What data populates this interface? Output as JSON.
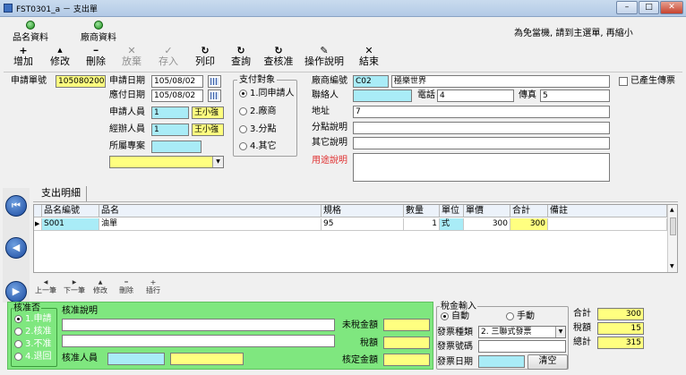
{
  "window": {
    "title": "FST0301_a － 支出單",
    "min": "–",
    "max": "□",
    "close": "✕"
  },
  "tabs": [
    {
      "label": "品名資料"
    },
    {
      "label": "廠商資料"
    }
  ],
  "notice": "為免當機, 請到主選單, 再縮小",
  "toolbar": [
    {
      "glyph": "+",
      "label": "增加",
      "enabled": true
    },
    {
      "glyph": "▲",
      "label": "修改",
      "enabled": true
    },
    {
      "glyph": "━",
      "label": "刪除",
      "enabled": true
    },
    {
      "glyph": "✕",
      "label": "放棄",
      "enabled": false
    },
    {
      "glyph": "✓",
      "label": "存入",
      "enabled": false
    },
    {
      "glyph": "↻",
      "label": "列印",
      "enabled": true
    },
    {
      "glyph": "↻",
      "label": "查詢",
      "enabled": true
    },
    {
      "glyph": "↻",
      "label": "查核准",
      "enabled": true
    },
    {
      "glyph": "✎",
      "label": "操作說明",
      "enabled": true
    },
    {
      "glyph": "✕",
      "label": "結束",
      "enabled": true
    }
  ],
  "form": {
    "req_no_label": "申請單號",
    "req_no": "1050802002",
    "req_date_label": "申請日期",
    "req_date": "105/08/02",
    "pay_date_label": "應付日期",
    "pay_date": "105/08/02",
    "applicant_label": "申請人員",
    "applicant_id": "1",
    "applicant_name": "王小強",
    "handler_label": "經辦人員",
    "handler_id": "1",
    "handler_name": "王小強",
    "project_label": "所屬專案",
    "project": "",
    "select_value": ""
  },
  "payment": {
    "title": "支付對象",
    "options": [
      {
        "label": "1.同申請人",
        "checked": true
      },
      {
        "label": "2.廠商",
        "checked": false
      },
      {
        "label": "3.分點",
        "checked": false
      },
      {
        "label": "4.其它",
        "checked": false
      }
    ]
  },
  "vendor": {
    "code_label": "廠商編號",
    "code": "C02",
    "name": "極樂世界",
    "contact_label": "聯絡人",
    "contact": "",
    "phone_label": "電話",
    "phone": "4",
    "fax_label": "傳真",
    "fax": "5",
    "address_label": "地址",
    "address": "7",
    "branch_label": "分點說明",
    "branch": "",
    "other_label": "其它說明",
    "other": "",
    "purpose_label": "用途說明",
    "purpose": "",
    "fax_check_label": "已產生傳票"
  },
  "detail": {
    "tab_label": "支出明細",
    "columns": [
      "品名編號",
      "品名",
      "規格",
      "數量",
      "單位",
      "單價",
      "合計",
      "備註"
    ],
    "rows": [
      {
        "code": "S001",
        "name": "油單",
        "spec": "95",
        "qty": "1",
        "unit": "式",
        "price": "300",
        "total": "300",
        "note": ""
      }
    ],
    "nav": [
      "上一筆",
      "下一筆",
      "修改",
      "刪除",
      "插行"
    ],
    "nav_glyphs": [
      "◀",
      "▶",
      "▲",
      "━",
      "+"
    ]
  },
  "approval": {
    "title": "核准否",
    "options": [
      {
        "label": "1.申請",
        "checked": true
      },
      {
        "label": "2.核准",
        "checked": false
      },
      {
        "label": "3.不准",
        "checked": false
      },
      {
        "label": "4.退回",
        "checked": false
      }
    ],
    "desc_label": "核准說明",
    "approver_label": "核准人員",
    "untaxed_label": "未稅金額",
    "tax_label": "稅額",
    "approved_amount_label": "核定金額"
  },
  "tax": {
    "title": "稅金輸入",
    "auto_label": "自動",
    "manual_label": "手動",
    "invoice_type_label": "發票種類",
    "invoice_type": "2. 三聯式發票",
    "invoice_no_label": "發票號碼",
    "invoice_no": "",
    "invoice_date_label": "發票日期",
    "invoice_date": "",
    "clear_label": "清空"
  },
  "totals": {
    "sum_label": "合計",
    "sum": "300",
    "tax_label": "稅額",
    "tax": "15",
    "grand_label": "總計",
    "grand": "315"
  }
}
